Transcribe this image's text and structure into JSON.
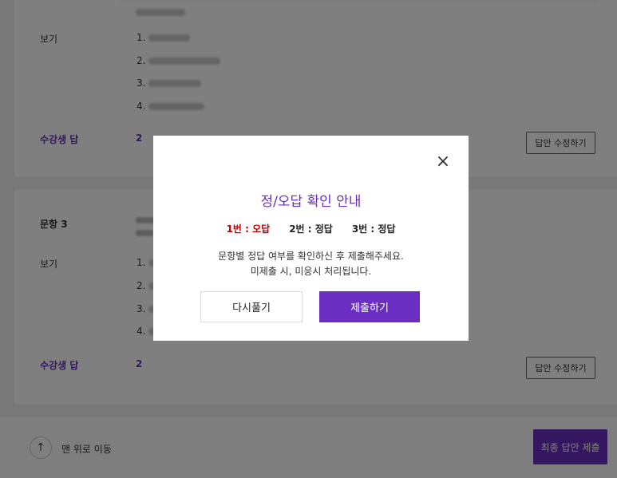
{
  "question2": {
    "options_label": "보기",
    "options": [
      "1.",
      "2.",
      "3.",
      "4."
    ],
    "answer_label": "수강생 답",
    "answer_value": "2",
    "edit_button": "답안 수정하기"
  },
  "question3": {
    "title": "문항 3",
    "options_label": "보기",
    "options": [
      "1.",
      "2.",
      "3.",
      "4."
    ],
    "answer_label": "수강생 답",
    "answer_value": "2",
    "edit_button": "답안 수정하기"
  },
  "footer": {
    "scroll_top_label": "맨 위로 이동",
    "final_submit": "최종 답안 제출"
  },
  "modal": {
    "title": "정/오답 확인 안내",
    "results": [
      {
        "text": "1번 : 오답",
        "status": "wrong"
      },
      {
        "text": "2번 : 정답",
        "status": "correct"
      },
      {
        "text": "3번 : 정답",
        "status": "correct"
      }
    ],
    "message_line1": "문항별 정답 여부를 확인하신 후 제출해주세요.",
    "message_line2": "미제출 시, 미응시 처리됩니다.",
    "retry_button": "다시풀기",
    "submit_button": "제출하기"
  },
  "icons": {
    "close": "close-icon",
    "arrow_up": "arrow-up-icon"
  },
  "colors": {
    "accent": "#6a2fc2",
    "wrong": "#c00000",
    "overlay": "rgba(0,0,0,0.5)"
  }
}
